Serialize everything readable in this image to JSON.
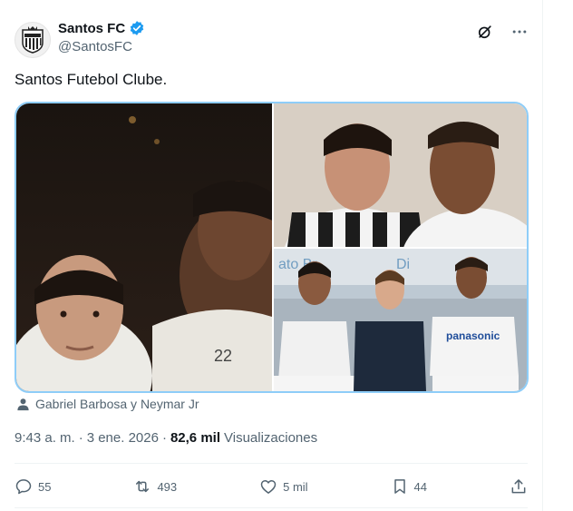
{
  "account": {
    "display_name": "Santos FC",
    "handle": "@SantosFC",
    "verified_icon": "verified-badge-icon",
    "accent": "#1d9bf0"
  },
  "tweet": {
    "text": "Santos Futebol Clube."
  },
  "media": {
    "tagged_users": "Gabriel Barbosa y Neymar Jr"
  },
  "meta": {
    "time": "9:43 a. m.",
    "separator": "·",
    "date": "3 ene. 2026",
    "separator2": "·",
    "views_count": "82,6 mil",
    "views_label": "Visualizaciones"
  },
  "actions": {
    "replies": "55",
    "reposts": "493",
    "likes": "5 mil",
    "bookmarks": "44"
  },
  "icons": [
    "grok-icon",
    "more-icon",
    "reply-icon",
    "repost-icon",
    "like-icon",
    "bookmark-icon",
    "share-icon",
    "person-icon"
  ]
}
